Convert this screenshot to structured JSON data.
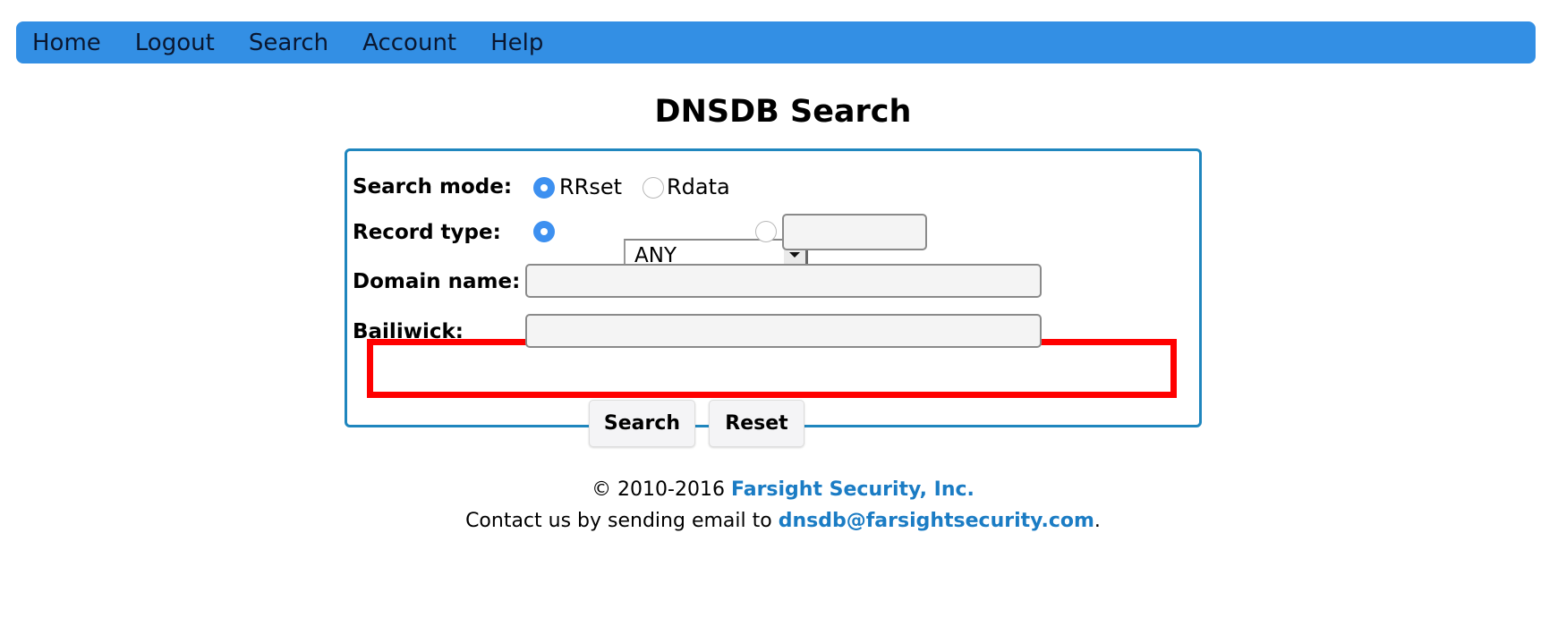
{
  "nav": {
    "items": [
      {
        "label": "Home"
      },
      {
        "label": "Logout"
      },
      {
        "label": "Search"
      },
      {
        "label": "Account"
      },
      {
        "label": "Help"
      }
    ]
  },
  "page": {
    "title": "DNSDB Search"
  },
  "form": {
    "search_mode": {
      "label": "Search mode:",
      "options": [
        {
          "label": "RRset",
          "selected": true
        },
        {
          "label": "Rdata",
          "selected": false
        }
      ]
    },
    "record_type": {
      "label": "Record type:",
      "select_value": "ANY",
      "select_option_selected": true,
      "custom_value": "",
      "custom_option_selected": false
    },
    "domain_name": {
      "label": "Domain name:",
      "value": ""
    },
    "bailiwick": {
      "label": "Bailiwick:",
      "value": "",
      "highlighted": true,
      "highlight_color": "#ff0000"
    },
    "buttons": {
      "search": "Search",
      "reset": "Reset"
    }
  },
  "footer": {
    "copyright_prefix": "© 2010-2016",
    "company_link": "Farsight Security, Inc.",
    "contact_prefix": "Contact us by sending email to",
    "email_link": "dnsdb@farsightsecurity.com",
    "contact_suffix": "."
  },
  "colors": {
    "nav_bg": "#338fe4",
    "box_border": "#1f86be",
    "link": "#1b7cc4",
    "radio_selected": "#3d90f0"
  }
}
